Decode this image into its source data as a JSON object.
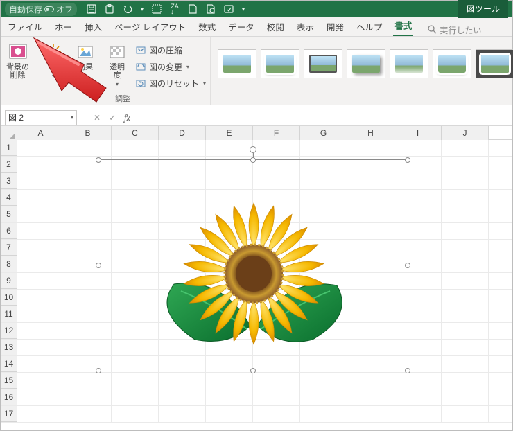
{
  "titlebar": {
    "autosave_label": "自動保存",
    "autosave_state": "オフ",
    "tool_tab": "図ツール"
  },
  "tabs": {
    "file": "ファイル",
    "home": "ホー",
    "insert": "挿入",
    "pagelayout": "ページ レイアウト",
    "formula": "数式",
    "data": "データ",
    "review": "校閲",
    "view": "表示",
    "developer": "開発",
    "help": "ヘルプ",
    "format": "書式",
    "search_hint": "実行したい"
  },
  "ribbon": {
    "remove_bg_label": "背景の\n削除",
    "corrections_label": "修",
    "effects_label": "効果",
    "transparency_label": "透明\n度",
    "compress_label": "図の圧縮",
    "change_label": "図の変更",
    "reset_label": "図のリセット",
    "group_adjust": "調整"
  },
  "namebox": {
    "value": "図 2"
  },
  "fx": {
    "fx": "fx"
  },
  "columns": [
    "A",
    "B",
    "C",
    "D",
    "E",
    "F",
    "G",
    "H",
    "I",
    "J"
  ],
  "rows": [
    "1",
    "2",
    "3",
    "4",
    "5",
    "6",
    "7",
    "8",
    "9",
    "10",
    "11",
    "12",
    "13",
    "14",
    "15",
    "16",
    "17"
  ],
  "styles": {
    "s1": "#dff3ff",
    "s2": "#cfeaf8",
    "s3": "#ccecda",
    "s4": "#d7e8c7",
    "s5": "#e6e0f3",
    "s6": "#f4e3c8"
  }
}
